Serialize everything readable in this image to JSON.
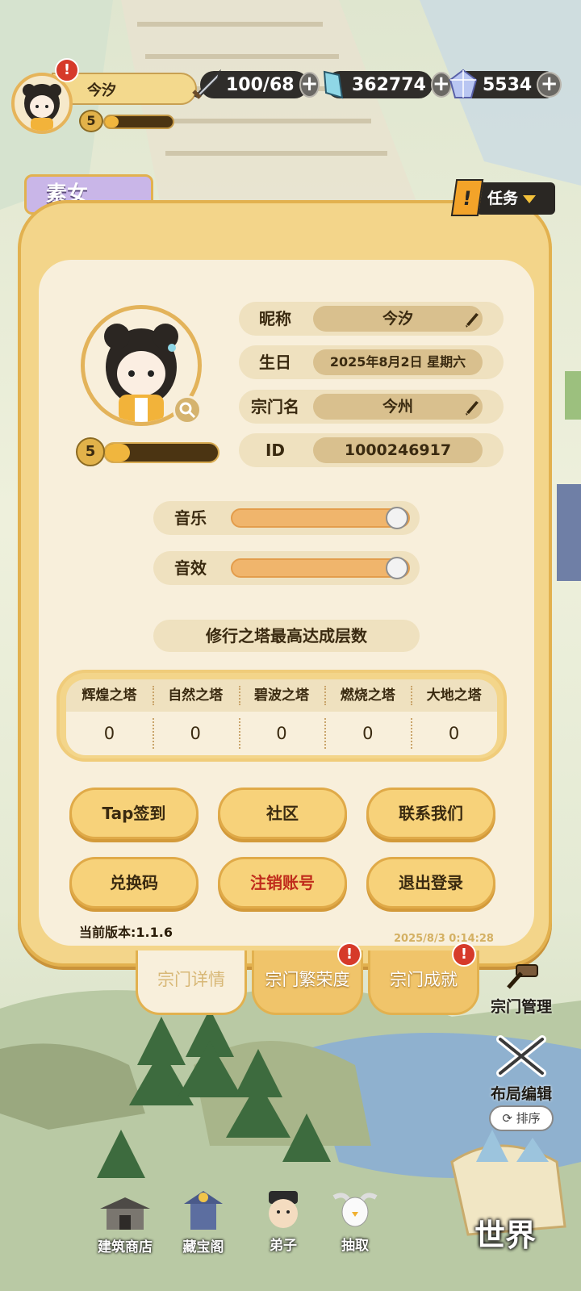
{
  "hud": {
    "player_name": "今汐",
    "player_level": "5",
    "player_xp_fraction": 0.2,
    "stamina": "100/68",
    "gold": "362774",
    "gems": "5534"
  },
  "side_tag": "素女",
  "task_button": "任务",
  "profile": {
    "level": "5",
    "xp_fraction": 0.22,
    "fields": [
      {
        "label": "昵称",
        "value": "今汐"
      },
      {
        "label": "生日",
        "value": "2025年8月2日 星期六"
      },
      {
        "label": "宗门名",
        "value": "今州"
      },
      {
        "label": "ID",
        "value": "1000246917"
      }
    ]
  },
  "settings": {
    "music_label": "音乐",
    "music_level": 1.0,
    "sfx_label": "音效",
    "sfx_level": 1.0
  },
  "tower": {
    "title": "修行之塔最高达成层数",
    "headers": [
      "辉煌之塔",
      "自然之塔",
      "碧波之塔",
      "燃烧之塔",
      "大地之塔"
    ],
    "values": [
      "0",
      "0",
      "0",
      "0",
      "0"
    ]
  },
  "buttons": {
    "tap_signin": "Tap签到",
    "community": "社区",
    "contact": "联系我们",
    "redeem": "兑换码",
    "delete_account": "注销账号",
    "logout": "退出登录"
  },
  "version": "当前版本:1.1.6",
  "timestamp": "2025/8/3 0:14:28",
  "tabs": [
    "宗门详情",
    "宗门繁荣度",
    "宗门成就"
  ],
  "side": {
    "manage": "宗门管理",
    "layout_edit": "布局编辑",
    "sort": "排序"
  },
  "bottom_nav": [
    "建筑商店",
    "藏宝阁",
    "弟子",
    "抽取"
  ],
  "world": "世界",
  "colors": {
    "panel": "#f3d58a",
    "panel_border": "#e2b14f",
    "inner": "#f8efdb",
    "alert": "#d63a2a",
    "danger_text": "#c02c1c"
  }
}
